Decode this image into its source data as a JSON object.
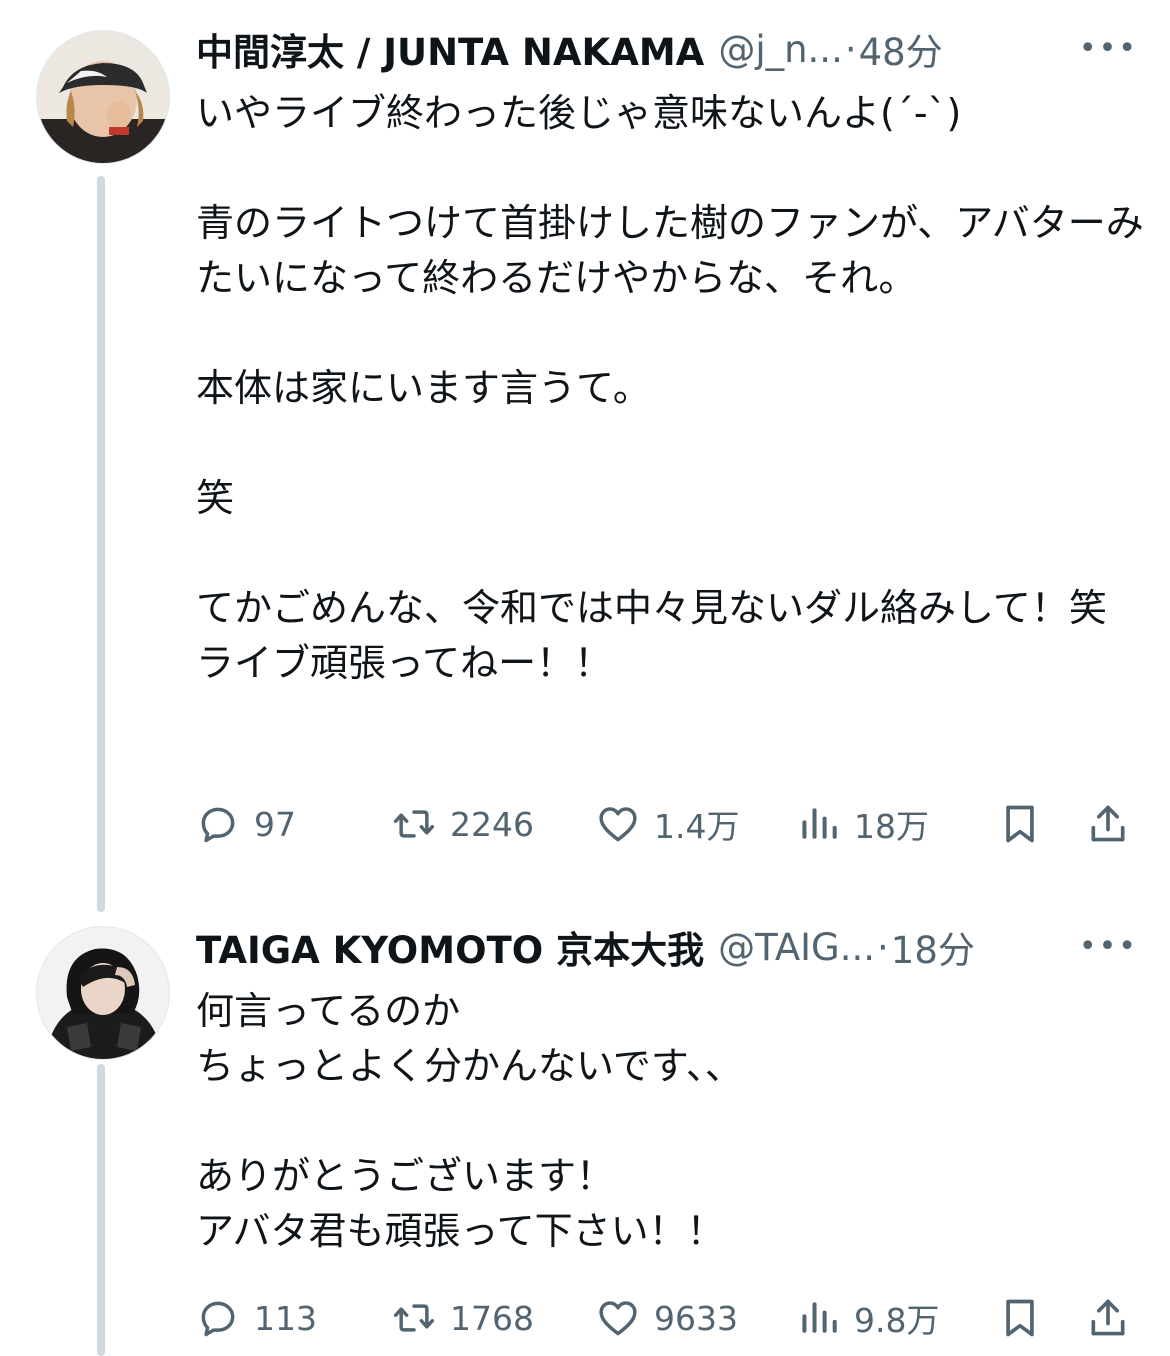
{
  "tweets": [
    {
      "name": "中間淳太 / JUNTA NAKAMA",
      "handle": "@j_n...",
      "separator": "·",
      "time": "48分",
      "more_icon": "more-horizontal-icon",
      "text": "いやライブ終わった後じゃ意味ないんよ(´-`)\n\n青のライトつけて首掛けした樹のファンが、アバターみたいになって終わるだけやからな、それ。\n\n本体は家にいます言うて。\n\n笑\n\nてかごめんな、令和では中々見ないダル絡みして！笑\nライブ頑張ってねー！！",
      "stats": {
        "replies": "97",
        "retweets": "2246",
        "likes": "1.4万",
        "views": "18万"
      }
    },
    {
      "name": "TAIGA KYOMOTO 京本大我",
      "handle": "@TAIG...",
      "separator": "·",
      "time": "18分",
      "more_icon": "more-horizontal-icon",
      "text": "何言ってるのか\nちょっとよく分かんないです、、\n\nありがとうございます！\nアバタ君も頑張って下さい！！",
      "stats": {
        "replies": "113",
        "retweets": "1768",
        "likes": "9633",
        "views": "9.8万"
      }
    }
  ],
  "icons": {
    "reply": "reply-icon",
    "retweet": "retweet-icon",
    "like": "heart-icon",
    "views": "views-icon",
    "bookmark": "bookmark-icon",
    "share": "share-icon"
  },
  "colors": {
    "text": "#0f1419",
    "secondary": "#536471",
    "thread_line": "#cfd9de"
  }
}
